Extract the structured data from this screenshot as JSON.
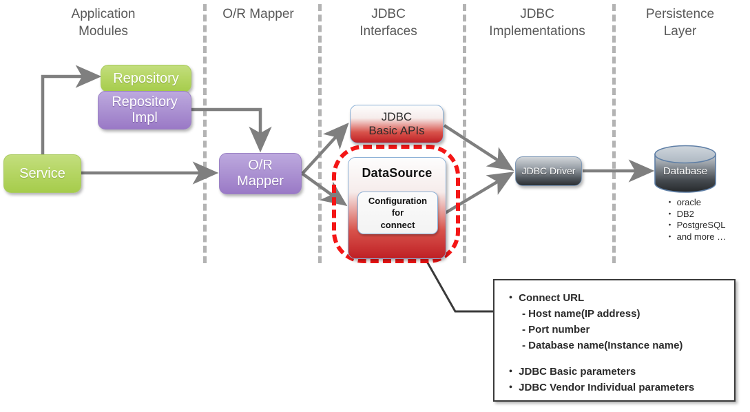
{
  "columns": [
    {
      "label": "Application\nModules",
      "line1": "Application",
      "line2": "Modules"
    },
    {
      "label": "O/R Mapper",
      "line1": "O/R Mapper",
      "line2": ""
    },
    {
      "label": "JDBC Interfaces",
      "line1": "JDBC",
      "line2": "Interfaces"
    },
    {
      "label": "JDBC Implementations",
      "line1": "JDBC",
      "line2": "Implementations"
    },
    {
      "label": "Persistence Layer",
      "line1": "Persistence",
      "line2": "Layer"
    }
  ],
  "nodes": {
    "repository": "Repository",
    "repository_impl_line1": "Repository",
    "repository_impl_line2": "Impl",
    "service": "Service",
    "or_mapper_line1": "O/R",
    "or_mapper_line2": "Mapper",
    "jdbc_basic_apis_line1": "JDBC",
    "jdbc_basic_apis_line2": "Basic APIs",
    "datasource_title": "DataSource",
    "configuration_line1": "Configuration",
    "configuration_line2": "for",
    "configuration_line3": "connect",
    "jdbc_driver": "JDBC Driver",
    "database": "Database"
  },
  "database_vendors": [
    "・ oracle",
    "・ DB2",
    "・ PostgreSQL",
    "・ and more …"
  ],
  "callout": {
    "line1": "・ Connect URL",
    "line2": "- Host name(IP address)",
    "line3": "- Port number",
    "line4": "- Database name(Instance name)",
    "line5": "・ JDBC Basic parameters",
    "line6": "・ JDBC Vendor Individual parameters"
  },
  "colors": {
    "green": "#b6d665",
    "purple": "#ad94d3",
    "red_accent": "#bf2025",
    "highlight_red": "#f41616",
    "steel_dark": "#2b2f33",
    "separator_gray": "#b3b3b3",
    "arrow_gray": "#7f7f7f",
    "leader_dark": "#3a3a3a",
    "header_text": "#595959"
  }
}
